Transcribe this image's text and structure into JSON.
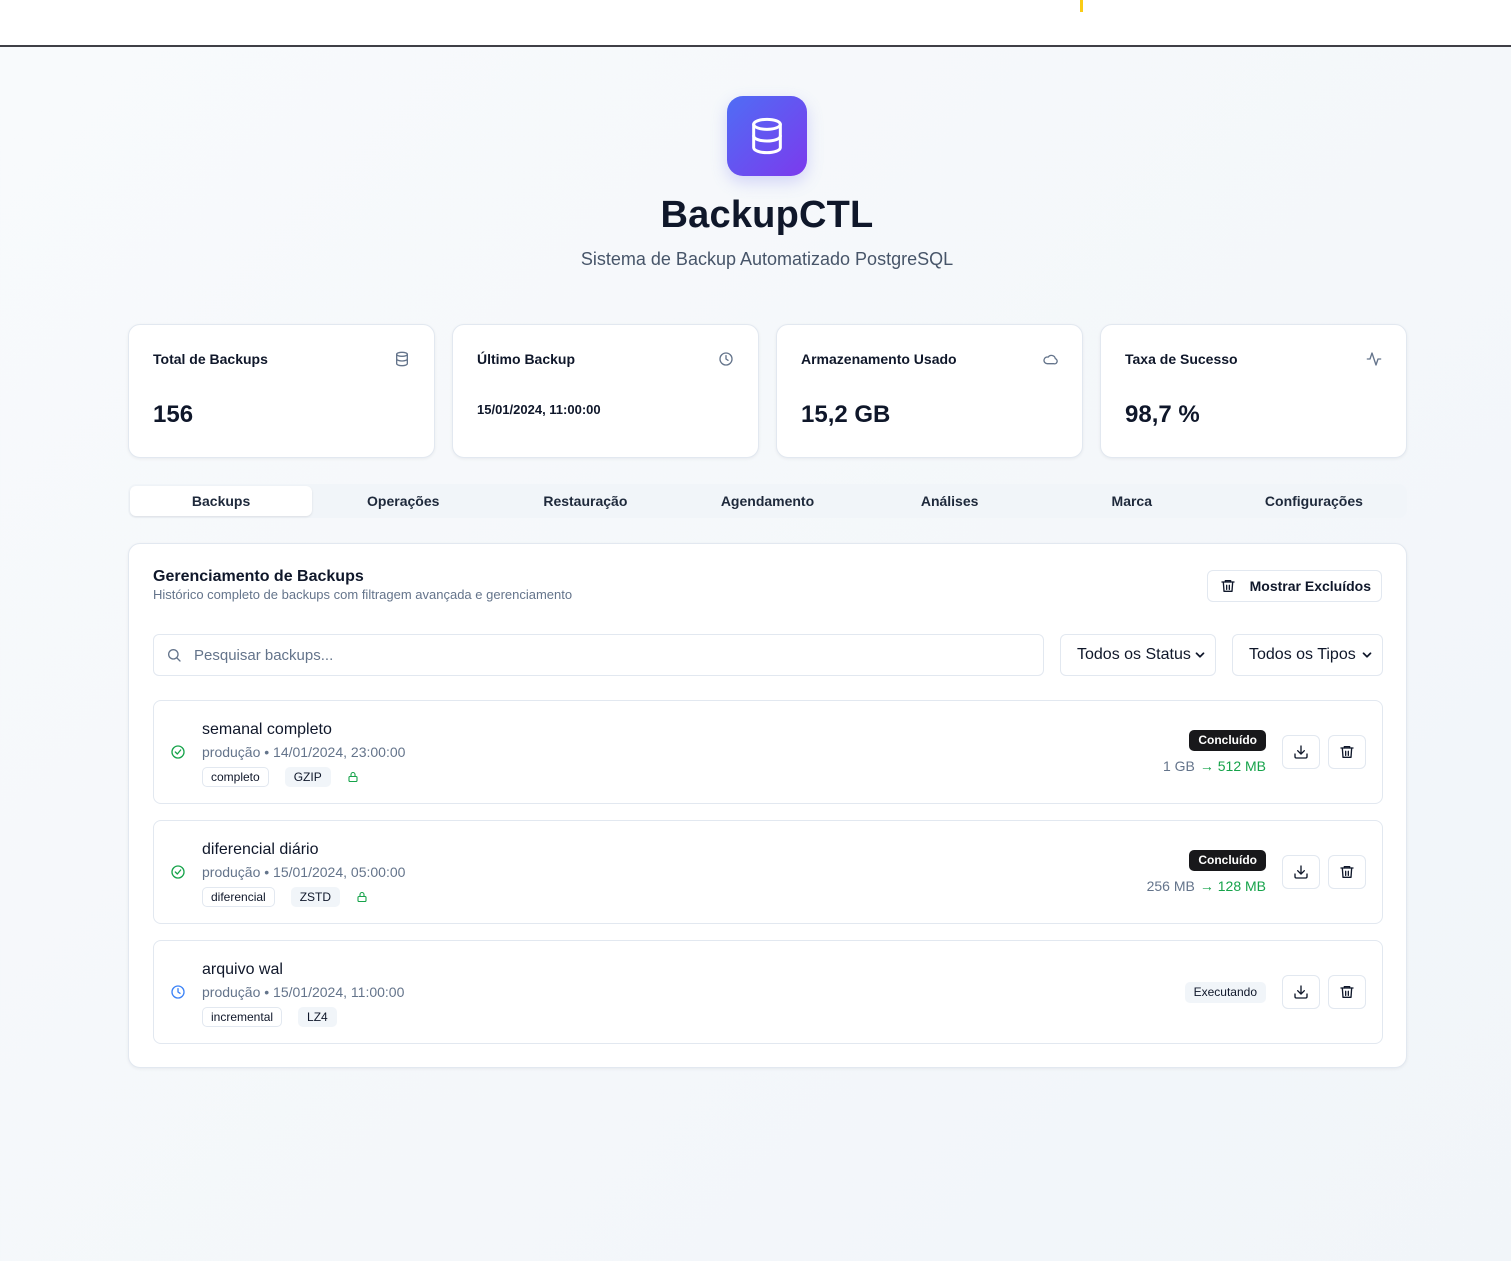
{
  "header": {
    "title": "BackupCTL",
    "subtitle": "Sistema de Backup Automatizado PostgreSQL"
  },
  "stats": [
    {
      "label": "Total de Backups",
      "value": "156",
      "icon": "database-icon"
    },
    {
      "label": "Último Backup",
      "value": "15/01/2024, 11:00:00",
      "icon": "clock-icon"
    },
    {
      "label": "Armazenamento Usado",
      "value": "15,2 GB",
      "icon": "cloud-icon"
    },
    {
      "label": "Taxa de Sucesso",
      "value": "98,7 %",
      "icon": "activity-icon"
    }
  ],
  "tabs": [
    "Backups",
    "Operações",
    "Restauração",
    "Agendamento",
    "Análises",
    "Marca",
    "Configurações"
  ],
  "active_tab": "Backups",
  "panel": {
    "title": "Gerenciamento de Backups",
    "description": "Histórico completo de backups com filtragem avançada e gerenciamento",
    "show_deleted_label": "Mostrar Excluídos",
    "search_placeholder": "Pesquisar backups...",
    "status_filter": "Todos os Status",
    "type_filter": "Todos os Tipos"
  },
  "backups": [
    {
      "name": "semanal completo",
      "meta": "produção • 14/01/2024, 23:00:00",
      "type_tag": "completo",
      "compression_tag": "GZIP",
      "encrypted": true,
      "status": "Concluído",
      "original_size": "1 GB",
      "compressed_size": "→ 512 MB",
      "status_color": "#16a34a"
    },
    {
      "name": "diferencial diário",
      "meta": "produção • 15/01/2024, 05:00:00",
      "type_tag": "diferencial",
      "compression_tag": "ZSTD",
      "encrypted": true,
      "status": "Concluído",
      "original_size": "256 MB",
      "compressed_size": "→ 128 MB",
      "status_color": "#16a34a"
    },
    {
      "name": "arquivo wal",
      "meta": "produção • 15/01/2024, 11:00:00",
      "type_tag": "incremental",
      "compression_tag": "LZ4",
      "encrypted": false,
      "status": "Executando",
      "status_color": "#3b82f6"
    }
  ],
  "colors": {
    "accent_start": "#4f6df5",
    "accent_end": "#7c3aed",
    "success": "#16a34a",
    "running": "#3b82f6",
    "badge_dark": "#18181b"
  }
}
